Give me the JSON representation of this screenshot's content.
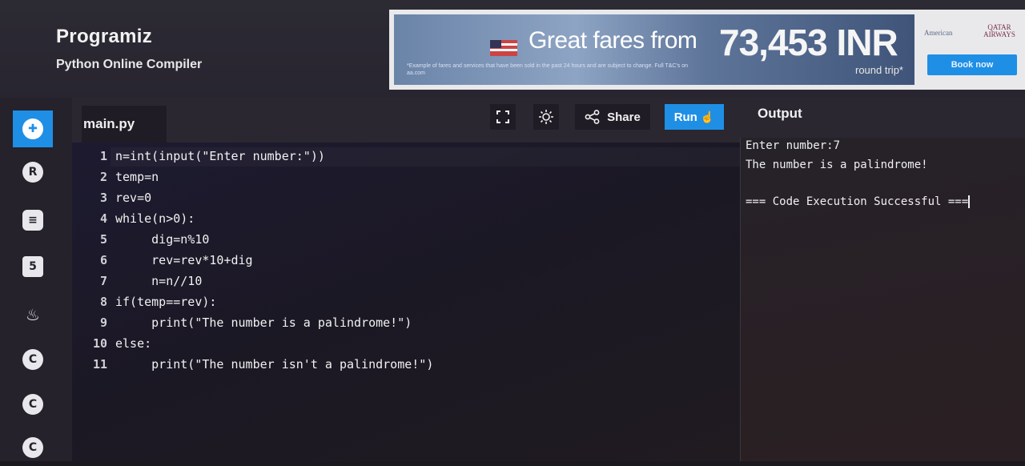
{
  "header": {
    "brand": "Programiz",
    "subtitle": "Python Online Compiler"
  },
  "ad": {
    "headline": "Great fares from",
    "price": "73,453 INR",
    "roundtrip": "round trip*",
    "fine_print": "*Example of fares and services that have been sold in the past 24 hours and are subject to change. Full T&C's on aa.com",
    "brand1": "American",
    "brand2": "QATAR AIRWAYS",
    "book_label": "Book now"
  },
  "sidebar": {
    "items": [
      {
        "name": "python",
        "icon": "python-icon",
        "glyph": "✚"
      },
      {
        "name": "r",
        "icon": "r-icon",
        "glyph": "R"
      },
      {
        "name": "sql",
        "icon": "database-icon",
        "glyph": "≡"
      },
      {
        "name": "html",
        "icon": "html5-icon",
        "glyph": "5"
      },
      {
        "name": "java",
        "icon": "java-icon",
        "glyph": "♨"
      },
      {
        "name": "c",
        "icon": "c-icon",
        "glyph": "C"
      },
      {
        "name": "cpp",
        "icon": "cpp-icon",
        "glyph": "C"
      },
      {
        "name": "csharp",
        "icon": "csharp-icon",
        "glyph": "C"
      }
    ]
  },
  "toolbar": {
    "file_name": "main.py",
    "fullscreen_icon": "fullscreen-icon",
    "theme_icon": "sun-icon",
    "share_label": "Share",
    "run_label": "Run"
  },
  "code": {
    "line_numbers": [
      "1",
      "2",
      "3",
      "4",
      "5",
      "6",
      "7",
      "8",
      "9",
      "10",
      "11"
    ],
    "lines": [
      "n=int(input(\"Enter number:\"))",
      "temp=n",
      "rev=0",
      "while(n>0):",
      "     dig=n%10",
      "     rev=rev*10+dig",
      "     n=n//10",
      "if(temp==rev):",
      "     print(\"The number is a palindrome!\")",
      "else:",
      "     print(\"The number isn't a palindrome!\")"
    ]
  },
  "output": {
    "title": "Output",
    "lines": [
      "Enter number:7",
      "The number is a palindrome!",
      "",
      "=== Code Execution Successful ==="
    ]
  },
  "colors": {
    "accent": "#1f8fe6",
    "background": "#1b1820"
  }
}
